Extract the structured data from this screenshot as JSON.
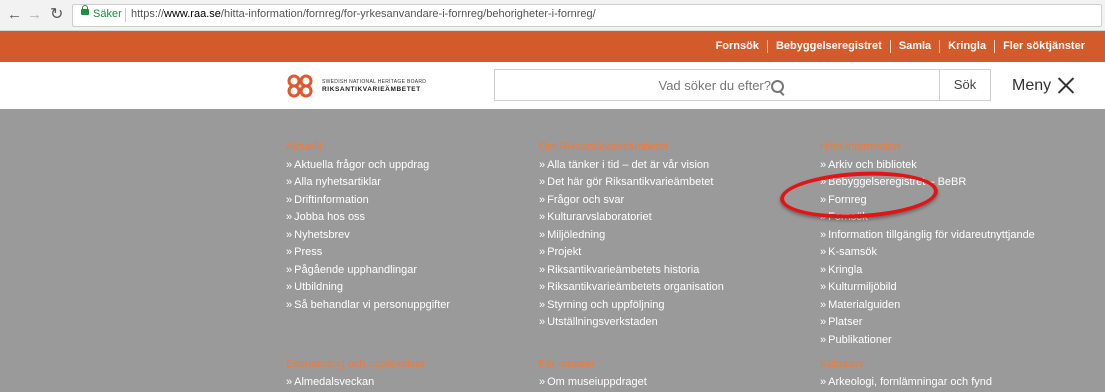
{
  "browser": {
    "secure_label": "Säker",
    "url_prefix": "https://",
    "url_host": "www.raa.se",
    "url_path": "/hitta-information/fornreg/for-yrkesanvandare-i-fornreg/behorigheter-i-fornreg/"
  },
  "topbar": {
    "links": [
      "Fornsök",
      "Bebyggelseregistret",
      "Samla",
      "Kringla",
      "Fler söktjänster"
    ],
    "color": "#d35a2b"
  },
  "header": {
    "logo_line1": "SWEDISH NATIONAL HERITAGE BOARD",
    "logo_line2": "RIKSANTIKVARIEÄMBETET",
    "search_placeholder": "Vad söker du efter?",
    "search_button": "Sök",
    "menu_label": "Meny"
  },
  "menu": {
    "chevron": "»",
    "heading_color": "#f07a3a",
    "columns": [
      {
        "heading": "Aktuellt",
        "items": [
          "Aktuella frågor och uppdrag",
          "Alla nyhetsartiklar",
          "Driftinformation",
          "Jobba hos oss",
          "Nyhetsbrev",
          "Press",
          "Pågående upphandlingar",
          "Utbildning",
          "Så behandlar vi personuppgifter"
        ]
      },
      {
        "heading": "Om Riksantikvarieämbetet",
        "items": [
          "Alla tänker i tid – det är vår vision",
          "Det här gör Riksantikvarieämbetet",
          "Frågor och svar",
          "Kulturarvslaboratoriet",
          "Miljöledning",
          "Projekt",
          "Riksantikvarieämbetets historia",
          "Riksantikvarieämbetets organisation",
          "Styrning och uppföljning",
          "Utställningsverkstaden"
        ]
      },
      {
        "heading": "Hitta information",
        "items": [
          "Arkiv och bibliotek",
          "Bebyggelseregistret – BeBR",
          "Fornreg",
          "Fornsök",
          "Information tillgänglig för vidareutnyttjande",
          "K-samsök",
          "Kringla",
          "Kulturmiljöbild",
          "Materialguiden",
          "Platser",
          "Publikationer"
        ]
      }
    ],
    "second_row": [
      {
        "heading": "Evenemang och upplevelser",
        "items": [
          "Almedalsveckan"
        ]
      },
      {
        "heading": "För museer",
        "items": [
          "Om museiuppdraget"
        ]
      },
      {
        "heading": "Kulturarv",
        "items": [
          "Arkeologi, fornlämningar och fynd"
        ]
      }
    ]
  },
  "annotation": {
    "color": "#e31414",
    "target": "Fornreg"
  }
}
